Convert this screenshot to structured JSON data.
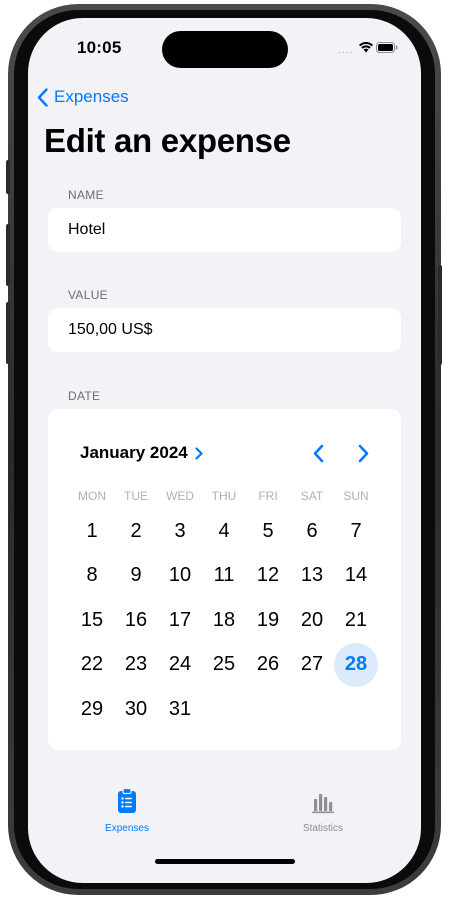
{
  "status_bar": {
    "time": "10:05",
    "signal": "....",
    "wifi_icon": "wifi-icon",
    "battery_icon": "battery-icon"
  },
  "nav": {
    "back_label": "Expenses",
    "back_icon": "chevron-left-icon"
  },
  "page": {
    "title": "Edit an expense"
  },
  "form": {
    "name_label": "NAME",
    "name_value": "Hotel",
    "value_label": "VALUE",
    "value_value": "150,00 US$",
    "date_label": "DATE"
  },
  "calendar": {
    "month_label": "January 2024",
    "weekdays": [
      "MON",
      "TUE",
      "WED",
      "THU",
      "FRI",
      "SAT",
      "SUN"
    ],
    "first_weekday_offset": 0,
    "days_in_month": 31,
    "selected_day": 28,
    "accent_color": "#007aff",
    "selected_bg_color": "#dcebfb"
  },
  "tab_bar": {
    "tabs": [
      {
        "label": "Expenses",
        "icon": "clipboard-list-icon",
        "active": true
      },
      {
        "label": "Statistics",
        "icon": "bar-chart-icon",
        "active": false
      }
    ]
  }
}
